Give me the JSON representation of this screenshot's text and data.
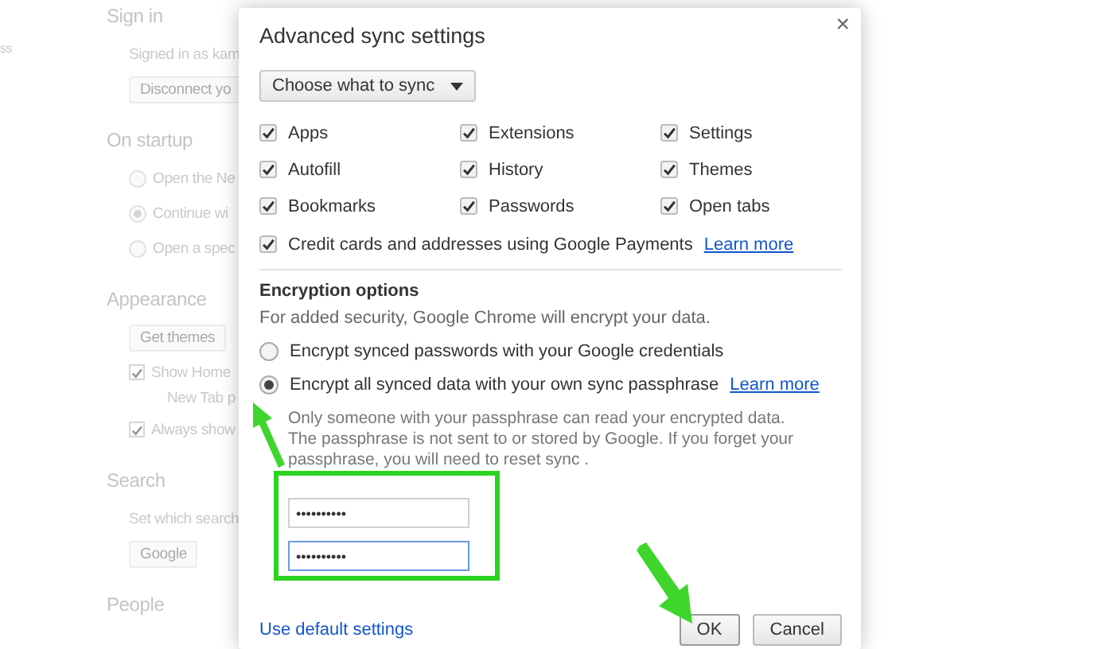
{
  "background_page": {
    "corner_text": "ss",
    "sections": [
      {
        "heading": "Sign in",
        "items": [
          {
            "kind": "text",
            "label": "Signed in as kam"
          },
          {
            "kind": "button",
            "label": "Disconnect yo"
          }
        ]
      },
      {
        "heading": "On startup",
        "items": [
          {
            "kind": "radio",
            "label": "Open the Ne",
            "selected": false
          },
          {
            "kind": "radio",
            "label": "Continue wi",
            "selected": true
          },
          {
            "kind": "radio",
            "label": "Open a spec",
            "selected": false
          }
        ]
      },
      {
        "heading": "Appearance",
        "items": [
          {
            "kind": "button",
            "label": "Get themes"
          },
          {
            "kind": "checkbox",
            "label": "Show Home",
            "checked": true
          },
          {
            "kind": "subtext",
            "label": "New Tab p"
          },
          {
            "kind": "checkbox",
            "label": "Always show",
            "checked": true
          }
        ]
      },
      {
        "heading": "Search",
        "items": [
          {
            "kind": "text",
            "label": "Set which search"
          },
          {
            "kind": "button",
            "label": "Google"
          }
        ]
      },
      {
        "heading": "People"
      }
    ]
  },
  "dialog": {
    "title": "Advanced sync settings",
    "close": "×",
    "dropdown": "Choose what to sync",
    "sync_items": [
      {
        "label": "Apps",
        "checked": true
      },
      {
        "label": "Extensions",
        "checked": true
      },
      {
        "label": "Settings",
        "checked": true
      },
      {
        "label": "Autofill",
        "checked": true
      },
      {
        "label": "History",
        "checked": true
      },
      {
        "label": "Themes",
        "checked": true
      },
      {
        "label": "Bookmarks",
        "checked": true
      },
      {
        "label": "Passwords",
        "checked": true
      },
      {
        "label": "Open tabs",
        "checked": true
      }
    ],
    "payments": {
      "label": "Credit cards and addresses using Google Payments",
      "link": "Learn more",
      "checked": true
    },
    "encryption": {
      "heading": "Encryption options",
      "description": "For added security, Google Chrome will encrypt your data.",
      "options": [
        {
          "label": "Encrypt synced passwords with your Google credentials",
          "selected": false
        },
        {
          "label": "Encrypt all synced data with your own sync passphrase",
          "link": "Learn more",
          "selected": true
        }
      ],
      "note": "Only someone with your passphrase can read your encrypted data. The passphrase is not sent to or stored by Google. If you forget your passphrase, you will need to reset sync .",
      "fields": [
        {
          "value": "••••••••••",
          "focused": false
        },
        {
          "value": "••••••••••",
          "focused": true
        }
      ]
    },
    "footer_link": "Use default settings",
    "buttons": [
      {
        "label": "OK",
        "default": true
      },
      {
        "label": "Cancel",
        "default": false
      }
    ]
  }
}
